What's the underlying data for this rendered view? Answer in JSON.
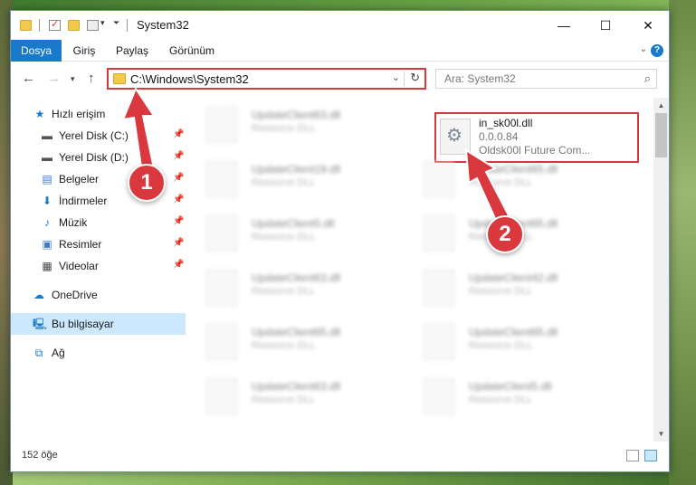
{
  "window": {
    "title": "System32"
  },
  "ribbon": {
    "tabs": [
      "Dosya",
      "Giriş",
      "Paylaş",
      "Görünüm"
    ]
  },
  "address": {
    "path": "C:\\Windows\\System32",
    "search_placeholder": "Ara: System32"
  },
  "sidebar": {
    "items": [
      {
        "label": "Hızlı erişim",
        "icon": "star-icon",
        "pinned": false
      },
      {
        "label": "Yerel Disk (C:)",
        "icon": "drive-icon",
        "pinned": true
      },
      {
        "label": "Yerel Disk (D:)",
        "icon": "drive-icon",
        "pinned": true
      },
      {
        "label": "Belgeler",
        "icon": "documents-icon",
        "pinned": true
      },
      {
        "label": "İndirmeler",
        "icon": "download-icon",
        "pinned": true
      },
      {
        "label": "Müzik",
        "icon": "music-icon",
        "pinned": true
      },
      {
        "label": "Resimler",
        "icon": "pictures-icon",
        "pinned": true
      },
      {
        "label": "Videolar",
        "icon": "video-icon",
        "pinned": true
      },
      {
        "label": "OneDrive",
        "icon": "cloud-icon",
        "pinned": false
      },
      {
        "label": "Bu bilgisayar",
        "icon": "computer-icon",
        "pinned": false
      },
      {
        "label": "Ağ",
        "icon": "network-icon",
        "pinned": false
      }
    ]
  },
  "files": {
    "left_column": [
      {
        "name": "UpdateClient63.dll",
        "desc": "Resource DLL"
      },
      {
        "name": "UpdateClient19.dll",
        "desc": "Resource DLL"
      },
      {
        "name": "UpdateClient5.dll",
        "desc": "Resource DLL"
      },
      {
        "name": "UpdateClient63.dll",
        "desc": "Resource DLL"
      },
      {
        "name": "UpdateClient65.dll",
        "desc": "Resource DLL"
      },
      {
        "name": "UpdateClient63.dll",
        "desc": "Resource DLL"
      }
    ],
    "right_column": [
      {
        "name": "UpdateClient65.dll",
        "desc": "Resource DLL"
      },
      {
        "name": "UpdateClient65.dll",
        "desc": "Resource DLL"
      },
      {
        "name": "UpdateClient42.dll",
        "desc": "Resource DLL"
      },
      {
        "name": "UpdateClient65.dll",
        "desc": "Resource DLL"
      },
      {
        "name": "UpdateClient5.dll",
        "desc": "Resource DLL"
      }
    ],
    "highlighted": {
      "name": "in_sk00l.dll",
      "version": "0.0.0.84",
      "desc": "Oldsk00l Future Com..."
    }
  },
  "status": {
    "count": "152 öğe"
  },
  "annotations": {
    "step1": "1",
    "step2": "2",
    "color": "#d9383f"
  }
}
